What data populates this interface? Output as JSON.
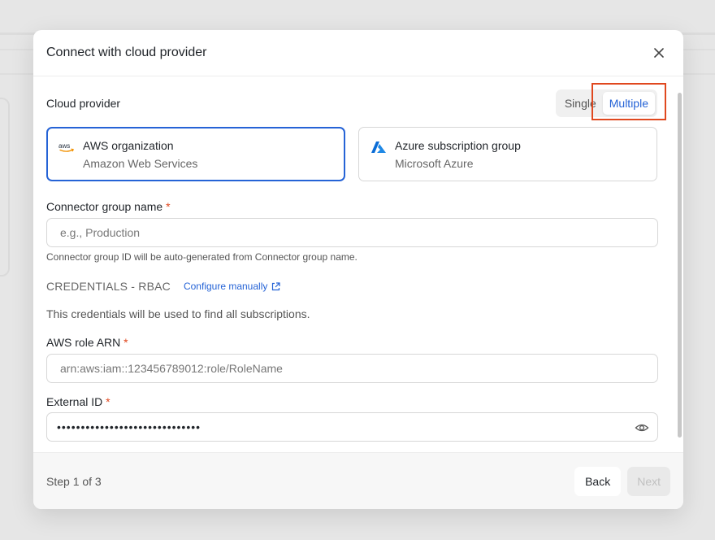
{
  "modal": {
    "title": "Connect with cloud provider"
  },
  "provider": {
    "label": "Cloud provider",
    "mode_options": [
      "Single",
      "Multiple"
    ],
    "selected_mode": "Multiple",
    "cards": [
      {
        "title": "AWS organization",
        "subtitle": "Amazon Web Services",
        "icon": "aws-icon",
        "selected": true
      },
      {
        "title": "Azure subscription group",
        "subtitle": "Microsoft Azure",
        "icon": "azure-icon",
        "selected": false
      }
    ]
  },
  "group_name": {
    "label": "Connector group name",
    "required_mark": "*",
    "placeholder": "e.g., Production",
    "value": "",
    "help": "Connector group ID will be auto-generated from Connector group name."
  },
  "credentials": {
    "title": "CREDENTIALS - RBAC",
    "configure_link": "Configure manually",
    "description": "This credentials will be used to find all subscriptions."
  },
  "role_arn": {
    "label": "AWS role ARN",
    "required_mark": "*",
    "placeholder": "arn:aws:iam::123456789012:role/RoleName",
    "value": ""
  },
  "external_id": {
    "label": "External ID",
    "required_mark": "*",
    "masked_value": "••••••••••••••••••••••••••••••"
  },
  "footer": {
    "step": "Step 1 of 3",
    "back": "Back",
    "next": "Next"
  },
  "colors": {
    "accent": "#2563d6",
    "required": "#e0481f",
    "highlight": "#e0481f",
    "aws_orange": "#f29100",
    "azure_blue": "#0a6cd6"
  }
}
